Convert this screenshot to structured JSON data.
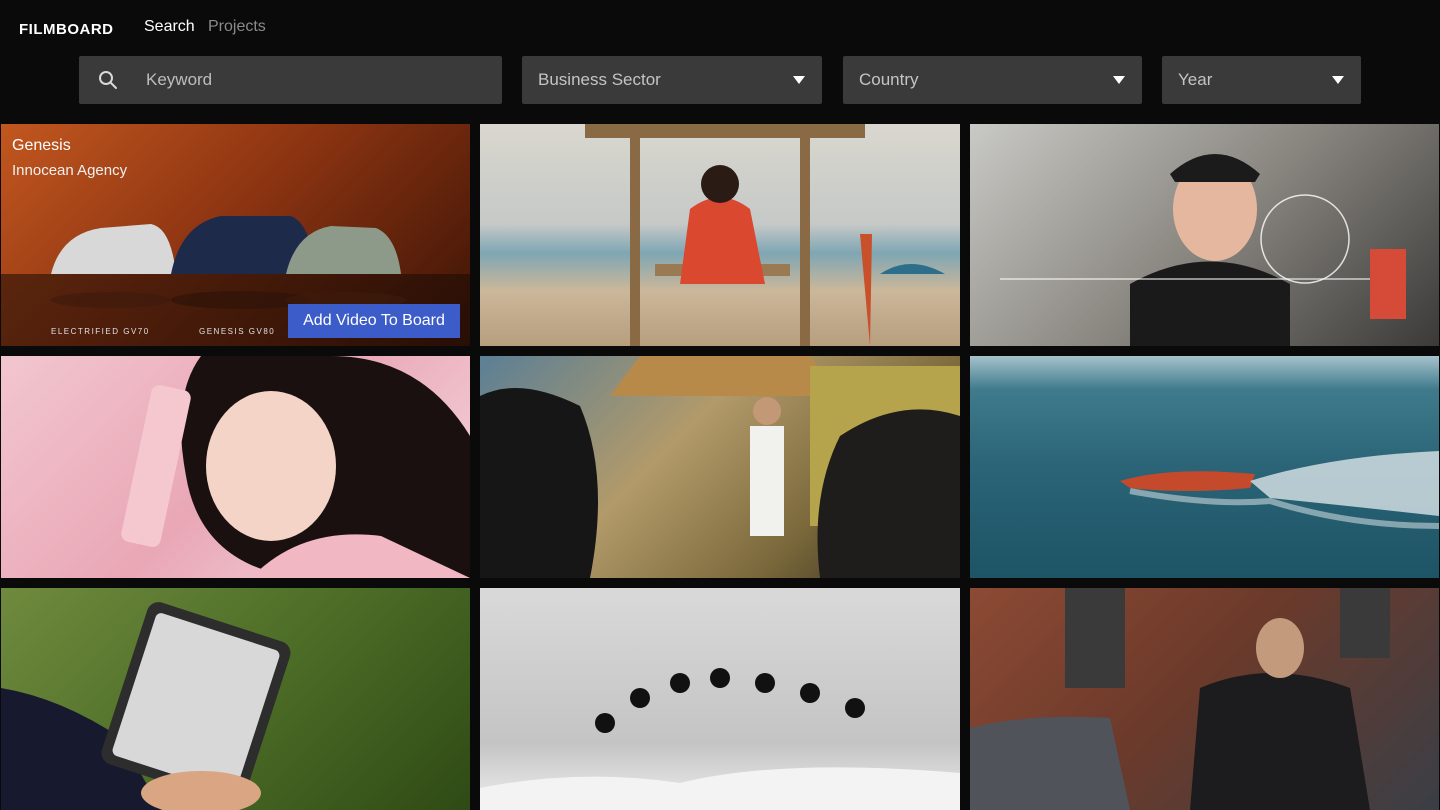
{
  "app": {
    "logo": "FILMBOARD"
  },
  "nav": {
    "search": "Search",
    "projects": "Projects"
  },
  "filters": {
    "keyword_placeholder": "Keyword",
    "business_sector": "Business Sector",
    "country": "Country",
    "year": "Year"
  },
  "videos": [
    {
      "title": "Genesis",
      "agency": "Innocean Agency",
      "captions": [
        "ELECTRIFIED GV70",
        "GENESIS GV80"
      ],
      "action_label": "Add Video To Board"
    },
    {},
    {},
    {},
    {},
    {},
    {},
    {},
    {}
  ],
  "colors": {
    "accent": "#3b5cc9",
    "background": "#0a0a0a",
    "field": "#3a3a3a"
  }
}
